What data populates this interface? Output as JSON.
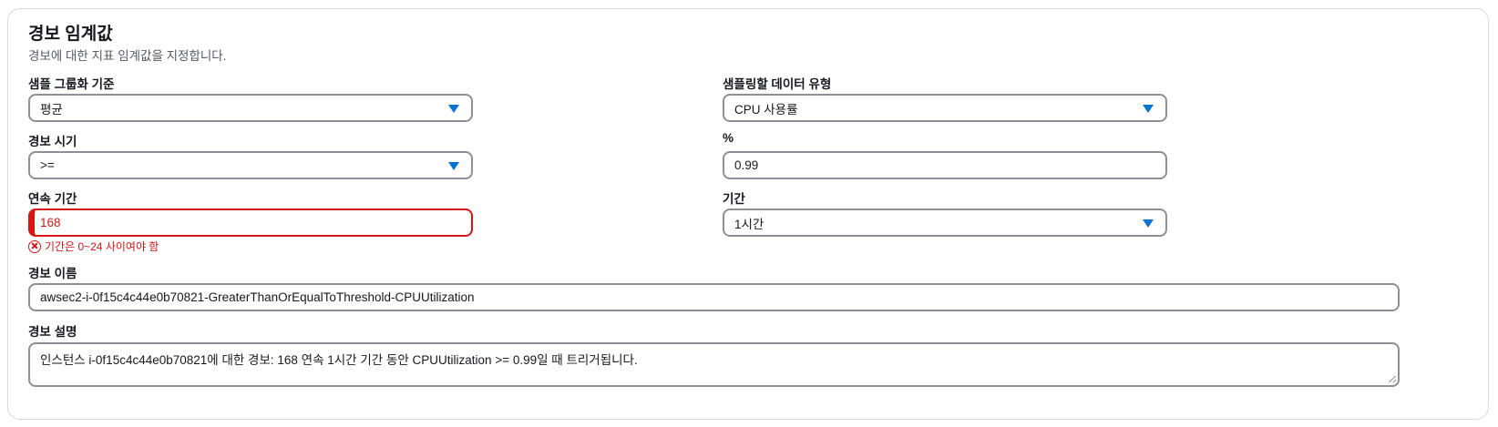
{
  "header": {
    "title": "경보 임계값",
    "subtitle": "경보에 대한 지표 임계값을 지정합니다."
  },
  "fields": {
    "grouping": {
      "label": "샘플 그룹화 기준",
      "value": "평균"
    },
    "data_type": {
      "label": "샘플링할 데이터 유형",
      "value": "CPU 사용률"
    },
    "alarm_when": {
      "label": "경보 시기",
      "value": ">="
    },
    "percent": {
      "label": "%",
      "value": "0.99"
    },
    "consecutive": {
      "label": "연속 기간",
      "value": "168",
      "error": "기간은 0~24 사이여야 함"
    },
    "period": {
      "label": "기간",
      "value": "1시간"
    },
    "alarm_name": {
      "label": "경보 이름",
      "value": "awsec2-i-0f15c4c44e0b70821-GreaterThanOrEqualToThreshold-CPUUtilization"
    },
    "alarm_description": {
      "label": "경보 설명",
      "value": "인스턴스 i-0f15c4c44e0b70821에 대한 경보: 168 연속 1시간 기간 동안 CPUUtilization >= 0.99일 때 트리거됩니다."
    }
  },
  "colors": {
    "accent": "#0972d3",
    "error": "#d91515",
    "border": "#8d9096"
  }
}
